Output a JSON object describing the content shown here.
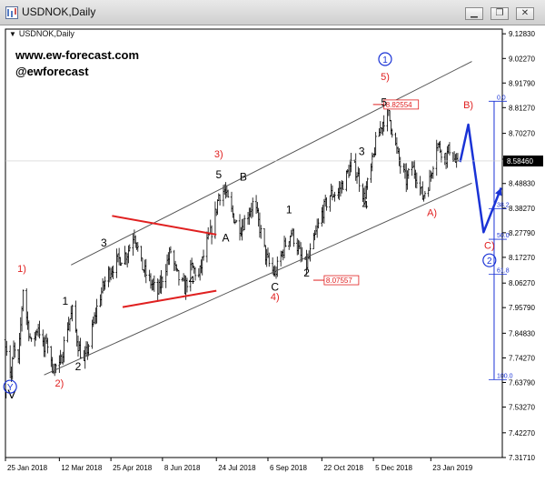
{
  "window": {
    "title": "USDNOK,Daily",
    "buttons": {
      "minimize": "▁",
      "restore": "❐",
      "close": "✕"
    }
  },
  "chart_subtitle": "USDNOK,Daily",
  "watermark": {
    "line1": "www.ew-forecast.com",
    "line2": "@ewforecast"
  },
  "colors": {
    "price_bars": "#000000",
    "wave_red": "#e02020",
    "wave_blue": "#1a33d6",
    "fib_line": "#1a33d6",
    "channel": "#555555",
    "current_price_bg": "#000000"
  },
  "chart_data": {
    "type": "line",
    "style": "ohlc-bars",
    "symbol": "USDNOK",
    "timeframe": "Daily",
    "x_type": "date",
    "xlim": [
      "2018-01-25",
      "2019-03-25"
    ],
    "ylim": [
      7.317,
      9.1483
    ],
    "y_ticks": [
      "9.12830",
      "9.02270",
      "8.91790",
      "8.81270",
      "8.70270",
      "8.59230",
      "8.48830",
      "8.38270",
      "8.27790",
      "8.17270",
      "8.06270",
      "7.95790",
      "7.84830",
      "7.74270",
      "7.63790",
      "7.53270",
      "7.42270",
      "7.31710"
    ],
    "x_ticks": [
      {
        "label": "25 Jan 2018",
        "date": "2018-01-25"
      },
      {
        "label": "12 Mar 2018",
        "date": "2018-03-12"
      },
      {
        "label": "25 Apr 2018",
        "date": "2018-04-25"
      },
      {
        "label": "8 Jun 2018",
        "date": "2018-06-08"
      },
      {
        "label": "24 Jul 2018",
        "date": "2018-07-24"
      },
      {
        "label": "6 Sep 2018",
        "date": "2018-09-06"
      },
      {
        "label": "22 Oct 2018",
        "date": "2018-10-22"
      },
      {
        "label": "5 Dec 2018",
        "date": "2018-12-05"
      },
      {
        "label": "23 Jan 2019",
        "date": "2019-01-23"
      }
    ],
    "current_price": "8.58460",
    "price_path": [
      [
        "2018-01-25",
        7.82
      ],
      [
        "2018-01-30",
        7.66
      ],
      [
        "2018-02-01",
        7.78
      ],
      [
        "2018-02-05",
        7.72
      ],
      [
        "2018-02-09",
        8.04
      ],
      [
        "2018-02-12",
        7.92
      ],
      [
        "2018-02-16",
        7.8
      ],
      [
        "2018-02-22",
        7.88
      ],
      [
        "2018-02-27",
        7.77
      ],
      [
        "2018-03-01",
        7.83
      ],
      [
        "2018-03-05",
        7.71
      ],
      [
        "2018-03-12",
        7.7
      ],
      [
        "2018-03-19",
        7.88
      ],
      [
        "2018-03-23",
        7.94
      ],
      [
        "2018-03-28",
        7.8
      ],
      [
        "2018-04-02",
        7.72
      ],
      [
        "2018-04-08",
        7.84
      ],
      [
        "2018-04-14",
        7.98
      ],
      [
        "2018-04-22",
        8.1
      ],
      [
        "2018-05-01",
        8.16
      ],
      [
        "2018-05-09",
        8.19
      ],
      [
        "2018-05-15",
        8.28
      ],
      [
        "2018-05-21",
        8.14
      ],
      [
        "2018-05-27",
        8.08
      ],
      [
        "2018-06-04",
        8.02
      ],
      [
        "2018-06-10",
        8.12
      ],
      [
        "2018-06-15",
        8.2
      ],
      [
        "2018-06-20",
        8.1
      ],
      [
        "2018-06-27",
        8.04
      ],
      [
        "2018-07-03",
        8.13
      ],
      [
        "2018-07-09",
        8.09
      ],
      [
        "2018-07-15",
        8.22
      ],
      [
        "2018-07-21",
        8.3
      ],
      [
        "2018-07-26",
        8.44
      ],
      [
        "2018-07-31",
        8.46
      ],
      [
        "2018-08-05",
        8.38
      ],
      [
        "2018-08-10",
        8.32
      ],
      [
        "2018-08-14",
        8.3
      ],
      [
        "2018-08-20",
        8.36
      ],
      [
        "2018-08-25",
        8.41
      ],
      [
        "2018-08-30",
        8.3
      ],
      [
        "2018-09-04",
        8.18
      ],
      [
        "2018-09-08",
        8.13
      ],
      [
        "2018-09-12",
        8.1
      ],
      [
        "2018-09-16",
        8.16
      ],
      [
        "2018-09-20",
        8.22
      ],
      [
        "2018-09-26",
        8.28
      ],
      [
        "2018-10-01",
        8.22
      ],
      [
        "2018-10-05",
        8.16
      ],
      [
        "2018-10-09",
        8.14
      ],
      [
        "2018-10-15",
        8.24
      ],
      [
        "2018-10-22",
        8.36
      ],
      [
        "2018-10-29",
        8.44
      ],
      [
        "2018-11-05",
        8.45
      ],
      [
        "2018-11-12",
        8.52
      ],
      [
        "2018-11-17",
        8.58
      ],
      [
        "2018-11-22",
        8.52
      ],
      [
        "2018-11-27",
        8.43
      ],
      [
        "2018-12-02",
        8.52
      ],
      [
        "2018-12-07",
        8.66
      ],
      [
        "2018-12-12",
        8.74
      ],
      [
        "2018-12-17",
        8.8
      ],
      [
        "2018-12-21",
        8.72
      ],
      [
        "2018-12-27",
        8.58
      ],
      [
        "2019-01-02",
        8.5
      ],
      [
        "2019-01-07",
        8.56
      ],
      [
        "2019-01-11",
        8.52
      ],
      [
        "2019-01-16",
        8.43
      ],
      [
        "2019-01-22",
        8.5
      ],
      [
        "2019-01-28",
        8.66
      ],
      [
        "2019-02-01",
        8.63
      ],
      [
        "2019-02-05",
        8.6
      ],
      [
        "2019-02-08",
        8.64
      ],
      [
        "2019-02-13",
        8.58
      ],
      [
        "2019-02-17",
        8.54
      ]
    ],
    "channel_lines": [
      {
        "points": [
          [
            "2018-03-22",
            8.14
          ],
          [
            "2019-02-27",
            9.01
          ]
        ]
      },
      {
        "points": [
          [
            "2018-02-27",
            7.67
          ],
          [
            "2019-02-27",
            8.49
          ]
        ]
      }
    ],
    "triangle_lines": [
      {
        "points": [
          [
            "2018-04-26",
            8.35
          ],
          [
            "2018-07-24",
            8.27
          ]
        ]
      },
      {
        "points": [
          [
            "2018-05-05",
            7.96
          ],
          [
            "2018-07-24",
            8.03
          ]
        ]
      }
    ],
    "projection_path": [
      [
        "2019-02-17",
        8.58
      ],
      [
        "2019-02-24",
        8.74
      ],
      [
        "2019-03-09",
        8.28
      ],
      [
        "2019-03-24",
        8.47
      ]
    ],
    "fib_levels": [
      {
        "label": "0.0",
        "value": 8.84
      },
      {
        "label": "38.2",
        "value": 8.38
      },
      {
        "label": "50.0",
        "value": 8.25
      },
      {
        "label": "61.8",
        "value": 8.1
      },
      {
        "label": "100.0",
        "value": 7.65
      }
    ],
    "price_markers": [
      {
        "label": "8.82554",
        "value": 8.826,
        "date": "2018-12-14"
      },
      {
        "label": "8.07557",
        "value": 8.075,
        "date": "2018-10-24"
      }
    ],
    "wave_labels": [
      {
        "text": "1)",
        "date": "2018-02-08",
        "value": 8.11,
        "color": "red"
      },
      {
        "text": "2)",
        "date": "2018-03-12",
        "value": 7.62,
        "color": "red"
      },
      {
        "text": "3)",
        "date": "2018-07-26",
        "value": 8.6,
        "color": "red"
      },
      {
        "text": "4)",
        "date": "2018-09-12",
        "value": 7.99,
        "color": "red"
      },
      {
        "text": "5)",
        "date": "2018-12-15",
        "value": 8.93,
        "color": "red"
      },
      {
        "text": "A)",
        "date": "2019-01-24",
        "value": 8.35,
        "color": "red"
      },
      {
        "text": "B)",
        "date": "2019-02-24",
        "value": 8.81,
        "color": "red"
      },
      {
        "text": "C)",
        "date": "2019-03-14",
        "value": 8.21,
        "color": "red"
      },
      {
        "text": "1",
        "date": "2018-03-17",
        "value": 7.97,
        "color": "black"
      },
      {
        "text": "2",
        "date": "2018-03-28",
        "value": 7.69,
        "color": "black"
      },
      {
        "text": "3",
        "date": "2018-04-19",
        "value": 8.22,
        "color": "black"
      },
      {
        "text": "4",
        "date": "2018-07-03",
        "value": 8.06,
        "color": "black"
      },
      {
        "text": "5",
        "date": "2018-07-26",
        "value": 8.51,
        "color": "black"
      },
      {
        "text": "A",
        "date": "2018-08-01",
        "value": 8.24,
        "color": "black"
      },
      {
        "text": "B",
        "date": "2018-08-16",
        "value": 8.5,
        "color": "black"
      },
      {
        "text": "C",
        "date": "2018-09-12",
        "value": 8.03,
        "color": "black"
      },
      {
        "text": "1",
        "date": "2018-09-24",
        "value": 8.36,
        "color": "black"
      },
      {
        "text": "2",
        "date": "2018-10-09",
        "value": 8.09,
        "color": "black"
      },
      {
        "text": "3",
        "date": "2018-11-25",
        "value": 8.61,
        "color": "black"
      },
      {
        "text": "4",
        "date": "2018-11-28",
        "value": 8.38,
        "color": "black"
      },
      {
        "text": "5",
        "date": "2018-12-14",
        "value": 8.82,
        "color": "black"
      },
      {
        "text": "IV",
        "date": "2018-01-29",
        "value": 7.57,
        "color": "black"
      }
    ],
    "circled_labels": [
      {
        "text": "1",
        "date": "2018-12-15",
        "value": 9.02
      },
      {
        "text": "2",
        "date": "2019-03-14",
        "value": 8.16
      },
      {
        "text": "Y",
        "date": "2018-01-29",
        "value": 7.62
      }
    ]
  }
}
